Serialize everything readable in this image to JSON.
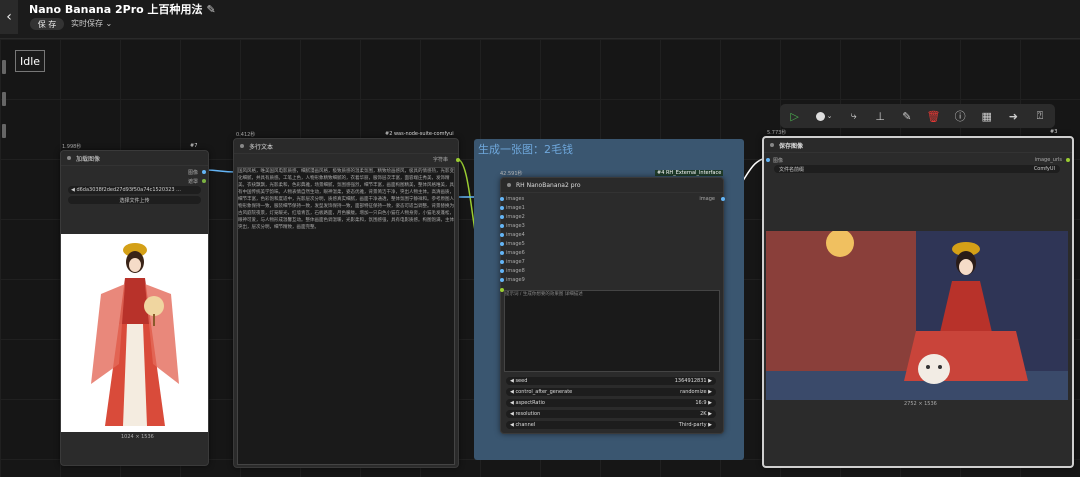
{
  "header": {
    "back_icon": "arrow-left-icon",
    "title": "Nano Banana 2Pro 上百种用法",
    "edit_icon": "pencil-icon",
    "save_label": "保 存",
    "autosave_label": "实时保存"
  },
  "status": {
    "idle": "Idle"
  },
  "load_node": {
    "time": "1.998秒",
    "badge": "#7",
    "title": "加载图像",
    "out_image": "图像",
    "out_mask": "遮罩",
    "filename": "d6da3038f2ded27d93f50a74c1520323 ...",
    "upload_label": "选择文件上传",
    "size": "1024 × 1536"
  },
  "text_node": {
    "time": "0.412秒",
    "badge": "#2 was-node-suite-comfyui",
    "title": "多行文本",
    "output": "字符串",
    "content": "国风风格，唯美国风电影质感，细腻漫画风格，极致质感的温柔氛围，精致绘画感风，极具的情感热，光影变化细腻，并具有质感。工笔上色，人物形象精致细腻的，衣着华丽，服饰层次丰富，面容端庄秀美，发饰精美。衣袂飘飘，光影柔和，色彩典雅，场景细腻，氛围感强烈，细节丰富，画面构图精美，整体风格唯美，具有中国传统美学韵味。人物表情自然生动，眼神温柔，姿态优雅，背景简洁干净，突出人物主体。高清画质，细节丰富，色彩饱和度适中，光影层次分明，质感真实细腻，画面干净通透，整体氛围宁静祥和。参考原图人物形象保持一致，服装细节保持一致，发型发饰保持一致，面部特征保持一致，姿态可适当调整。背景替换为古风庭院夜景，灯笼暖光，红墙青瓦，石板路面，月色朦胧。增加一只白色小猫在人物身旁，小猫毛发蓬松，眼神可爱，与人物形成温馨互动。整体画面色调温暖，光影柔和，氛围感强，具有电影质感。构图饱满，主体突出，层次分明，细节精致，画面完整。"
  },
  "group": {
    "title": "生成一张图：2毛钱",
    "time": "42.591秒",
    "badge": "#4 RH_External_Interface",
    "node_title": "RH NanoBanana2 pro",
    "inputs": [
      "images",
      "image1",
      "image2",
      "image3",
      "image4",
      "image5",
      "image6",
      "image7",
      "image8",
      "image9"
    ],
    "output": "image",
    "prompt_placeholder": "提示词 / 生成你想要的效果图 详细描述",
    "widgets": [
      {
        "name": "seed",
        "value": "1364912831"
      },
      {
        "name": "control_after_generate",
        "value": "randomize"
      },
      {
        "name": "aspectRatio",
        "value": "16:9"
      },
      {
        "name": "resolution",
        "value": "2K"
      },
      {
        "name": "channel",
        "value": "Third-party"
      }
    ]
  },
  "save_node": {
    "time": "5.773秒",
    "badge": "#3",
    "title": "保存图像",
    "input": "图像",
    "output": "image_urls",
    "prefix_label": "文件名前缀",
    "prefix_value": "ComfyUI",
    "size": "2752 × 1536"
  },
  "toolbar": {
    "icons": [
      "play-icon",
      "color-circle-icon",
      "bypass-icon",
      "pin-icon",
      "edit-icon",
      "delete-icon",
      "info-icon",
      "apps-icon",
      "arrow-right-icon",
      "help-icon"
    ]
  },
  "colors": {
    "accent_green": "#9acd32",
    "link_blue": "#64b5f6",
    "group_bg": "#3a5670",
    "group_title": "#6fa8dc"
  }
}
